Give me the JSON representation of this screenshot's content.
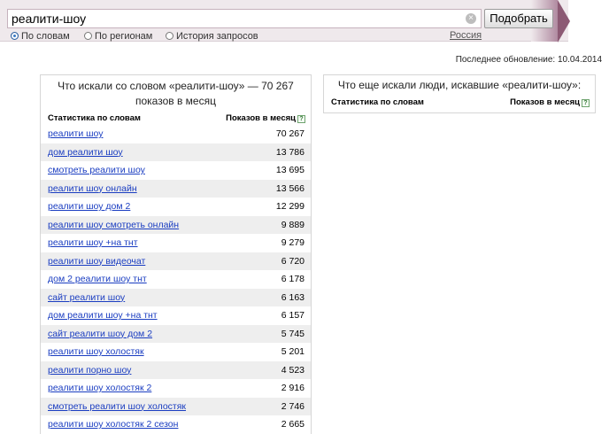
{
  "search": {
    "value": "реалити-шоу",
    "clear_glyph": "×",
    "button_label": "Подобрать"
  },
  "modes": [
    {
      "label": "По словам",
      "selected": true
    },
    {
      "label": "По регионам",
      "selected": false
    },
    {
      "label": "История запросов",
      "selected": false
    }
  ],
  "region": "Россия",
  "last_update": "Последнее обновление: 10.04.2014",
  "left_panel": {
    "title": "Что искали со словом «реалити-шоу» — 70 267 показов в месяц",
    "col_words": "Статистика по словам",
    "col_shows": "Показов в месяц",
    "help_glyph": "?",
    "rows": [
      {
        "keyword": "реалити шоу",
        "count": "70 267"
      },
      {
        "keyword": "дом реалити шоу",
        "count": "13 786"
      },
      {
        "keyword": "смотреть реалити шоу",
        "count": "13 695"
      },
      {
        "keyword": "реалити шоу онлайн",
        "count": "13 566"
      },
      {
        "keyword": "реалити шоу дом 2",
        "count": "12 299"
      },
      {
        "keyword": "реалити шоу смотреть онлайн",
        "count": "9 889"
      },
      {
        "keyword": "реалити шоу +на тнт",
        "count": "9 279"
      },
      {
        "keyword": "реалити шоу видеочат",
        "count": "6 720"
      },
      {
        "keyword": "дом 2 реалити шоу тнт",
        "count": "6 178"
      },
      {
        "keyword": "сайт реалити шоу",
        "count": "6 163"
      },
      {
        "keyword": "дом реалити шоу +на тнт",
        "count": "6 157"
      },
      {
        "keyword": "сайт реалити шоу дом 2",
        "count": "5 745"
      },
      {
        "keyword": "реалити шоу холостяк",
        "count": "5 201"
      },
      {
        "keyword": "реалити порно шоу",
        "count": "4 523"
      },
      {
        "keyword": "реалити шоу холостяк 2",
        "count": "2 916"
      },
      {
        "keyword": "смотреть реалити шоу холостяк",
        "count": "2 746"
      },
      {
        "keyword": "реалити шоу холостяк 2 сезон",
        "count": "2 665"
      }
    ]
  },
  "right_panel": {
    "title": "Что еще искали люди, искавшие «реалити-шоу»:",
    "col_words": "Статистика по словам",
    "col_shows": "Показов в месяц",
    "help_glyph": "?"
  }
}
